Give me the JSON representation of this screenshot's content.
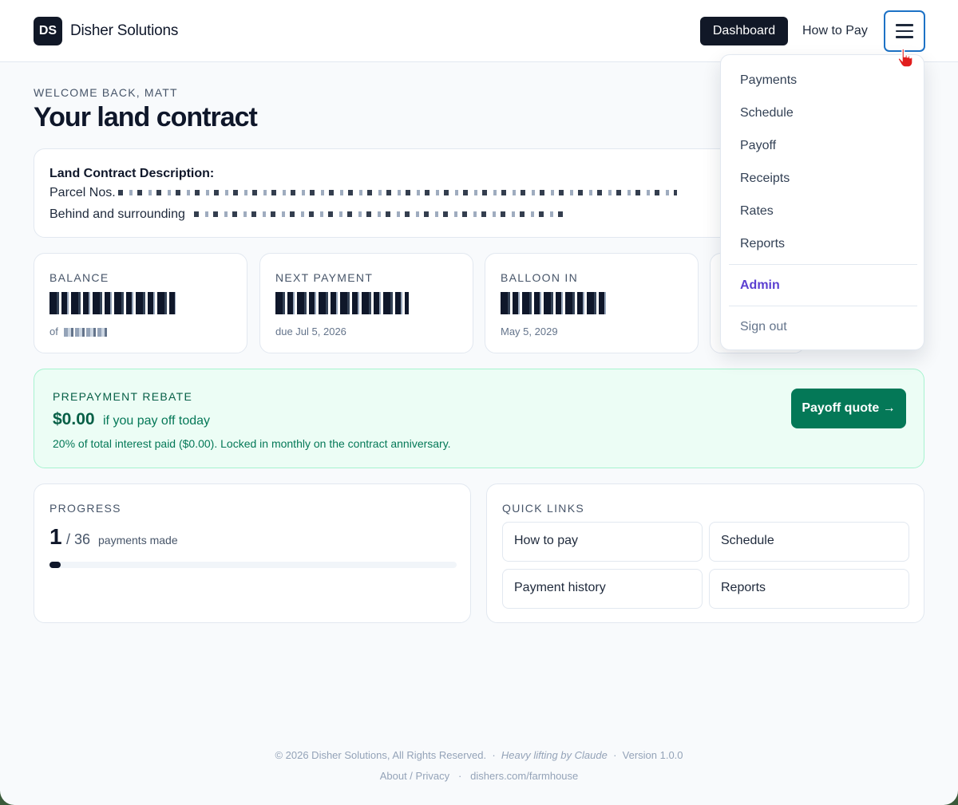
{
  "header": {
    "logo": "DS",
    "brand": "Disher Solutions",
    "nav_dashboard": "Dashboard",
    "nav_how_to_pay": "How to Pay"
  },
  "page": {
    "welcome": "WELCOME BACK, MATT",
    "title": "Your land contract"
  },
  "description": {
    "label": "Land Contract Description:",
    "line1": "Parcel Nos.",
    "line2": "Behind and surrounding"
  },
  "stats": [
    {
      "label": "BALANCE",
      "sub": "of"
    },
    {
      "label": "NEXT PAYMENT",
      "sub": "due Jul 5, 2026"
    },
    {
      "label": "BALLOON IN",
      "sub": "May 5, 2029"
    }
  ],
  "rebate": {
    "label": "PREPAYMENT REBATE",
    "amount": "$0.00",
    "amount_note": "if you pay off today",
    "footnote": "20% of total interest paid ($0.00). Locked in monthly on the contract anniversary.",
    "button": "Payoff quote →"
  },
  "progress": {
    "label": "PROGRESS",
    "made": "1",
    "total_text": "/ 36",
    "note": "payments made",
    "fraction": 0.0278
  },
  "quick_links": {
    "label": "QUICK LINKS",
    "items": [
      "How to pay",
      "Schedule",
      "Payment history",
      "Reports"
    ]
  },
  "menu": {
    "items": [
      "Payments",
      "Schedule",
      "Payoff",
      "Receipts",
      "Rates",
      "Reports"
    ],
    "admin": "Admin",
    "sign_out": "Sign out"
  },
  "footer": {
    "copyright": "© 2026 Disher Solutions, All Rights Reserved.",
    "credit": "Heavy lifting by Claude",
    "version": "Version 1.0.0",
    "about": "About / Privacy",
    "domain": "dishers.com/farmhouse"
  },
  "colors": {
    "primary_dark": "#111827",
    "accent_focus": "#1d72c6",
    "rebate_green": "#047857",
    "admin_purple": "#5b3fd1"
  },
  "icons": [
    "menu-icon",
    "pointer-cursor-icon"
  ]
}
